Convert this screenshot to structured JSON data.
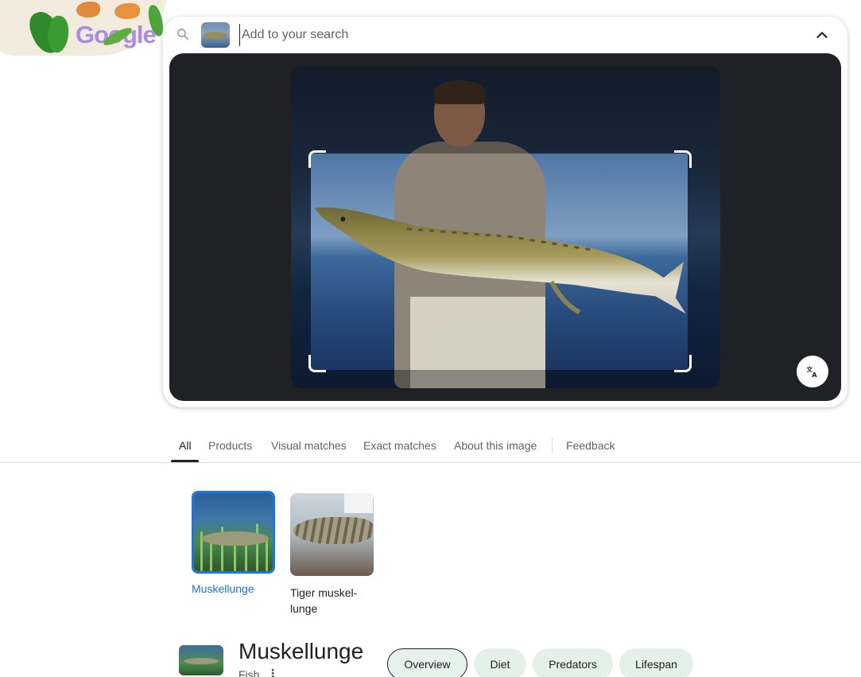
{
  "logo": {
    "text": "Google"
  },
  "search": {
    "placeholder": "Add to your search",
    "value": ""
  },
  "tabs": [
    {
      "label": "All",
      "active": true
    },
    {
      "label": "Products",
      "active": false
    },
    {
      "label": "Visual matches",
      "active": false
    },
    {
      "label": "Exact matches",
      "active": false
    },
    {
      "label": "About this image",
      "active": false
    },
    {
      "label": "Feedback",
      "active": false
    }
  ],
  "entities": [
    {
      "label": "Muskellunge",
      "selected": true
    },
    {
      "label": "Tiger muskel-lunge",
      "selected": false
    }
  ],
  "knowledge": {
    "title": "Muskellunge",
    "subtitle": "Fish",
    "chips": [
      {
        "label": "Overview",
        "active": true
      },
      {
        "label": "Diet",
        "active": false
      },
      {
        "label": "Predators",
        "active": false
      },
      {
        "label": "Lifespan",
        "active": false
      }
    ]
  },
  "icons": {
    "search": "search-icon",
    "collapse": "chevron-up-icon",
    "translate": "translate-icon",
    "more": "more-vert-icon"
  },
  "colors": {
    "accent": "#1a73e8",
    "panel": "#202124",
    "chip": "#e4f1e9"
  }
}
